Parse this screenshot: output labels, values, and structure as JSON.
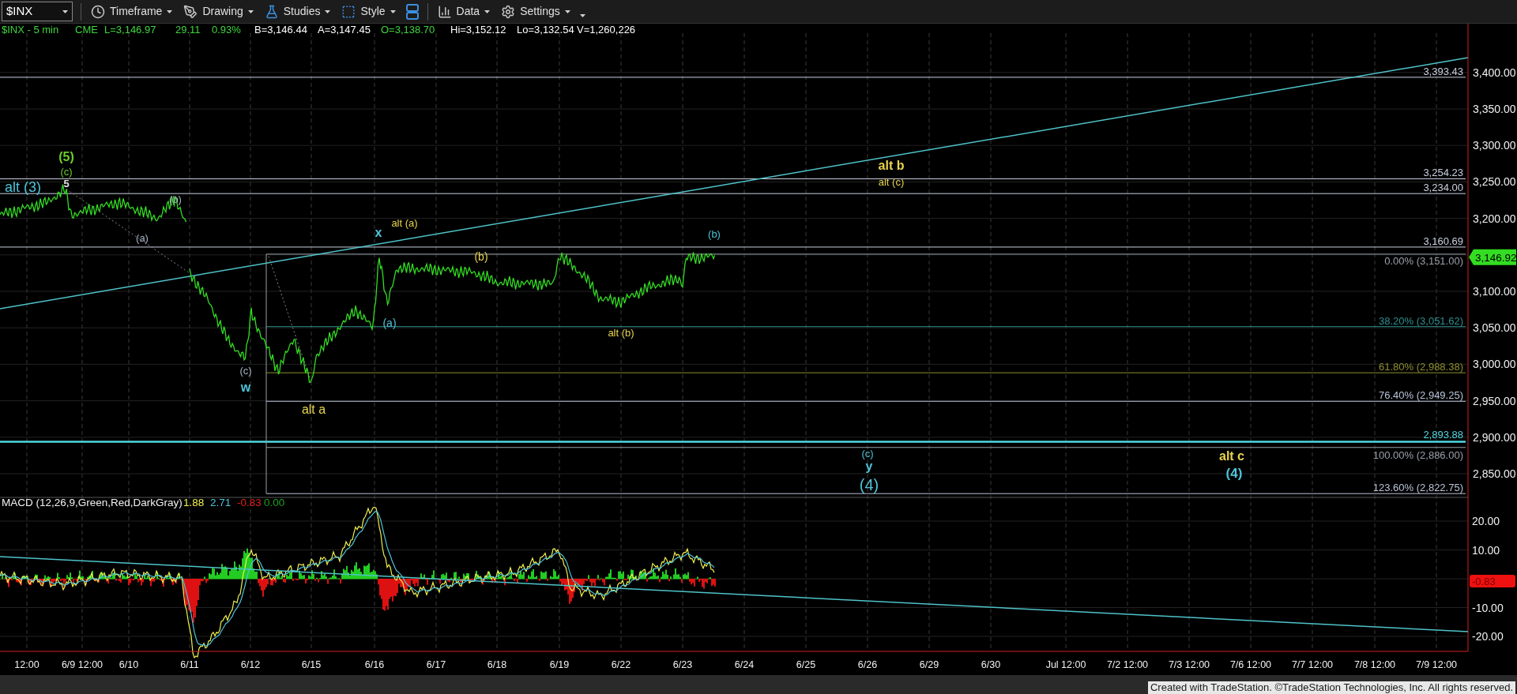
{
  "toolbar": {
    "symbol": "$INX",
    "menus": [
      {
        "label": "Timeframe",
        "kind": "clock"
      },
      {
        "label": "Drawing",
        "kind": "pen"
      },
      {
        "label": "Studies",
        "kind": "flask"
      },
      {
        "label": "Style",
        "kind": "style"
      },
      {
        "label": "Data",
        "kind": "bars"
      },
      {
        "label": "Settings",
        "kind": "gear"
      }
    ]
  },
  "quote": [
    {
      "text": "$INX - 5 min",
      "color": "#3ed63e"
    },
    {
      "text": "CME",
      "color": "#3ed63e"
    },
    {
      "text": "L=3,146.97",
      "color": "#3ed63e"
    },
    {
      "text": "29.11",
      "color": "#3ed63e"
    },
    {
      "text": "0.93%",
      "color": "#3ed63e"
    },
    {
      "text": "B=3,146.44",
      "color": "#ffffff"
    },
    {
      "text": "A=3,147.45",
      "color": "#ffffff"
    },
    {
      "text": "O=3,138.70",
      "color": "#3ed63e"
    },
    {
      "text": "Hi=3,152.12",
      "color": "#ffffff"
    },
    {
      "text": "Lo=3,132.54",
      "color": "#ffffff"
    },
    {
      "text": "V=1,260,226",
      "color": "#ffffff"
    }
  ],
  "price_axis": [
    "3,400.00",
    "3,350.00",
    "3,300.00",
    "3,250.00",
    "3,200.00",
    "3,100.00",
    "3,050.00",
    "3,000.00",
    "2,950.00",
    "2,900.00",
    "2,850.00"
  ],
  "last_price": "3,146.92",
  "levels": [
    {
      "label": "3,393.43",
      "color": "#c8d0e0"
    },
    {
      "label": "3,254.23",
      "color": "#c8d0e0"
    },
    {
      "label": "3,234.00",
      "color": "#c8d0e0"
    },
    {
      "label": "3,160.69",
      "color": "#c8d0e0"
    },
    {
      "label": "0.00% (3,151.00)",
      "color": "#9aa0a8"
    },
    {
      "label": "38.20% (3,051.62)",
      "color": "#2e8f8f"
    },
    {
      "label": "61.80% (2,988.38)",
      "color": "#8f8f2e"
    },
    {
      "label": "76.40% (2,949.25)",
      "color": "#b8c4d8"
    },
    {
      "label": "2,893.88",
      "color": "#4fd8e0"
    },
    {
      "label": "100.00% (2,886.00)",
      "color": "#9aa0a8"
    },
    {
      "label": "123.60% (2,822.75)",
      "color": "#b8c4d8"
    }
  ],
  "waves": [
    {
      "text": "alt (3)",
      "color": "#4fc3d9"
    },
    {
      "text": "(5)",
      "color": "#6ccf2a"
    },
    {
      "text": "(c)",
      "color": "#6ccf2a"
    },
    {
      "text": "5",
      "color": "#e0e0e0"
    },
    {
      "text": "(b)",
      "color": "#a8b4c8"
    },
    {
      "text": "(a)",
      "color": "#a8b4c8"
    },
    {
      "text": "(c)",
      "color": "#a8b4c8"
    },
    {
      "text": "w",
      "color": "#4fc3d9"
    },
    {
      "text": "alt a",
      "color": "#e8d44d"
    },
    {
      "text": "x",
      "color": "#4fc3d9"
    },
    {
      "text": "alt (a)",
      "color": "#e8d44d"
    },
    {
      "text": "(a)",
      "color": "#4fc3d9"
    },
    {
      "text": "(b)",
      "color": "#e8d44d"
    },
    {
      "text": "alt (b)",
      "color": "#e8d44d"
    },
    {
      "text": "(b)",
      "color": "#4fc3d9"
    },
    {
      "text": "alt b",
      "color": "#e8d44d"
    },
    {
      "text": "alt (c)",
      "color": "#e8d44d"
    },
    {
      "text": "(c)",
      "color": "#4fc3d9"
    },
    {
      "text": "y",
      "color": "#4fc3d9"
    },
    {
      "text": "(4)",
      "color": "#4fc3d9"
    },
    {
      "text": "alt c",
      "color": "#e8d44d"
    },
    {
      "text": "(4)",
      "color": "#4fc3d9"
    }
  ],
  "macd": {
    "title": "MACD (12,26,9,Green,Red,DarkGray)",
    "values": [
      {
        "text": "1.88",
        "color": "#f0f050"
      },
      {
        "text": "2.71",
        "color": "#4fc3d9"
      },
      {
        "text": "-0.83",
        "color": "#e02020"
      },
      {
        "text": "0.00",
        "color": "#20a020"
      }
    ],
    "axis": [
      "20.00",
      "10.00",
      "-10.00",
      "-20.00"
    ],
    "last_value": "-0.83"
  },
  "time_axis": [
    "12:00",
    "6/9 12:00",
    "6/10",
    "6/11",
    "6/12",
    "6/15",
    "6/16",
    "6/17",
    "6/18",
    "6/19",
    "6/22",
    "6/23",
    "6/24",
    "6/25",
    "6/26",
    "6/29",
    "6/30",
    "Jul 12:00",
    "7/2 12:00",
    "7/3 12:00",
    "7/6 12:00",
    "7/7 12:00",
    "7/8 12:00",
    "7/9 12:00"
  ],
  "footer": "Created with TradeStation. ©TradeStation Technologies, Inc. All rights reserved."
}
